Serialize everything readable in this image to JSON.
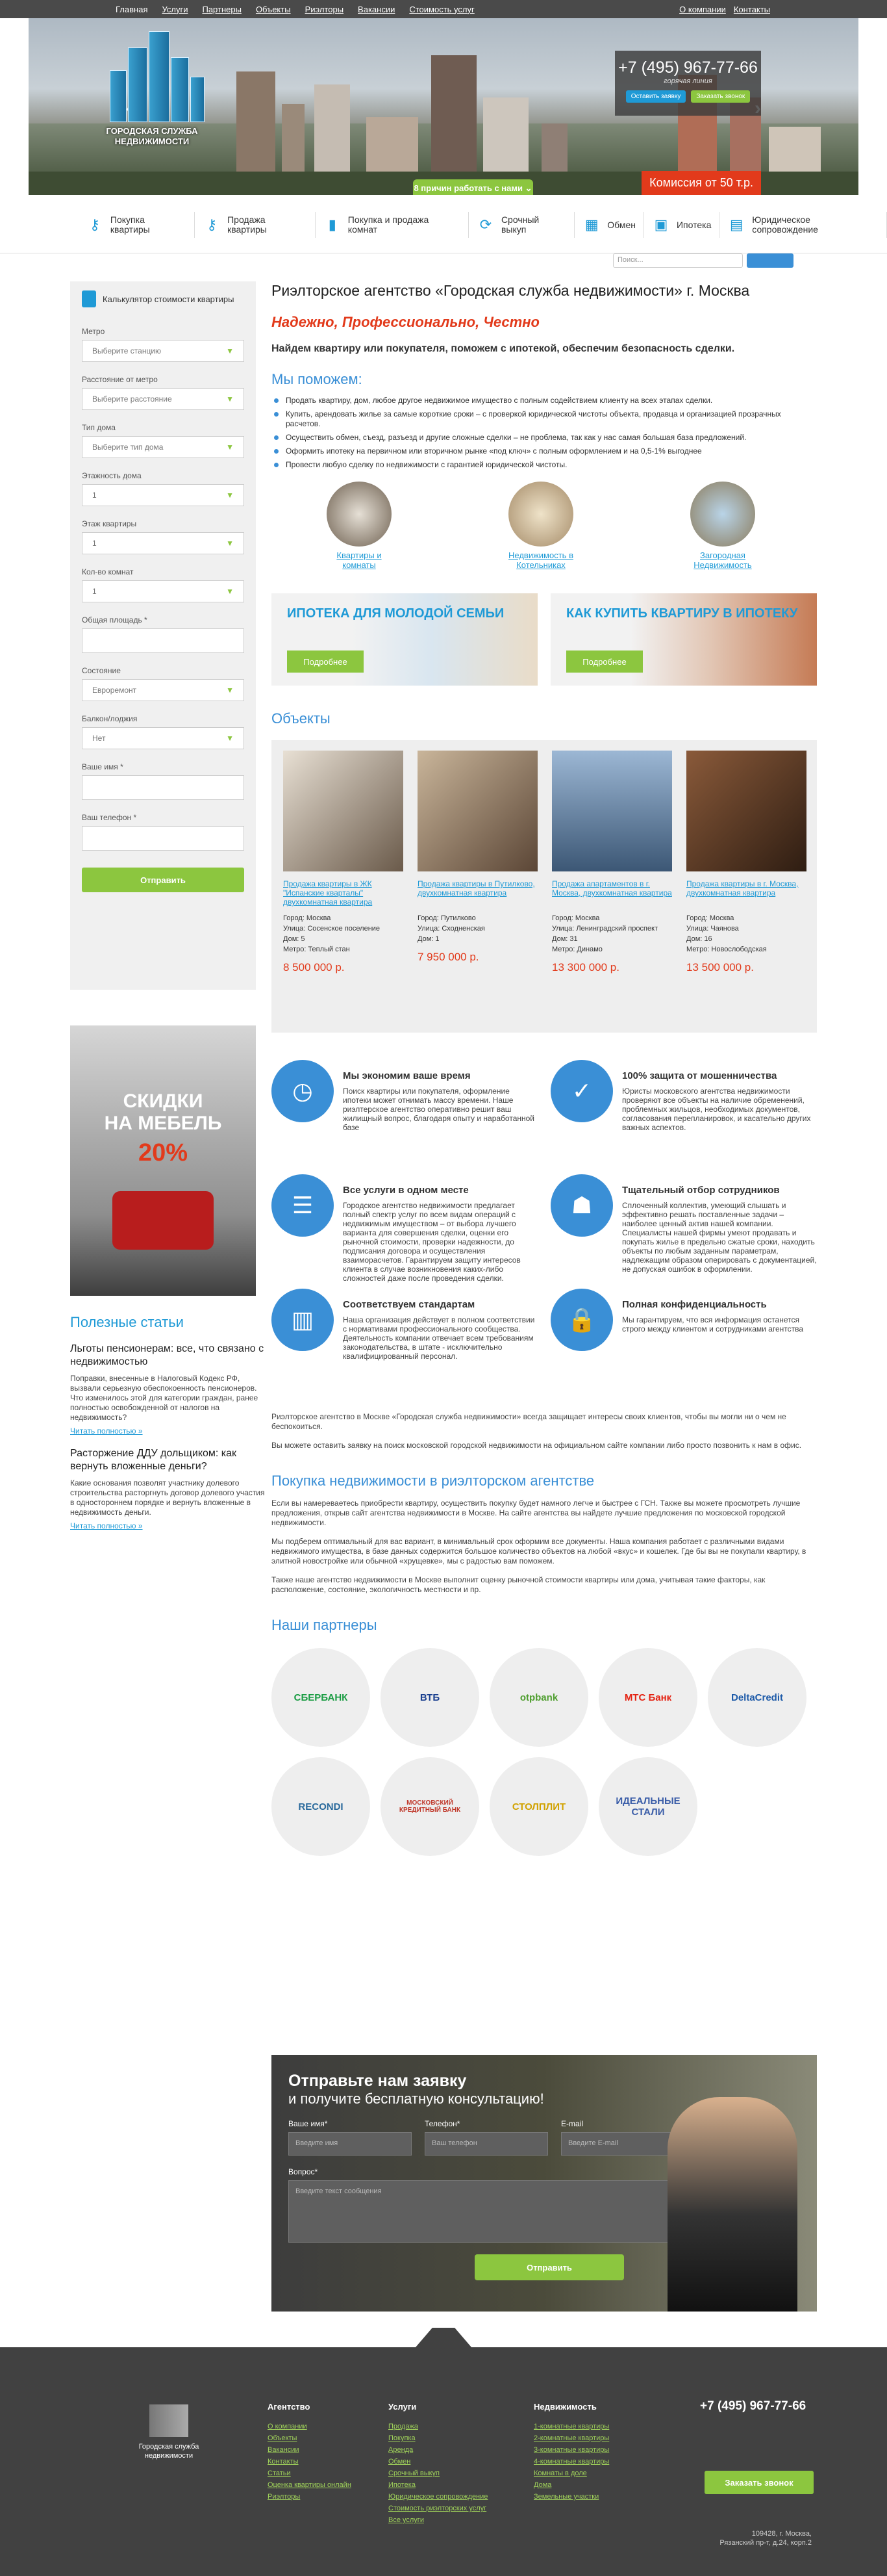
{
  "topnav": [
    "Главная",
    "Услуги",
    "Партнеры",
    "Объекты",
    "Риэлторы",
    "Вакансии",
    "Стоимость услуг"
  ],
  "topright": {
    "about": "О компании",
    "contacts": "Контакты"
  },
  "logo": "Городская служба недвижимости",
  "banner": {
    "phone": "+7 (495) 967-77-66",
    "phone_sub": "горячая линия",
    "btn1": "Оставить заявку",
    "btn2": "Заказать звонок",
    "commission": "Комиссия от 50 т.р.",
    "reasons": "8 причин работать с нами"
  },
  "nav": [
    {
      "label": "Покупка квартиры",
      "icon": "key-icon"
    },
    {
      "label": "Продажа квартиры",
      "icon": "key-icon"
    },
    {
      "label": "Покупка и продажа комнат",
      "icon": "bookmark-icon"
    },
    {
      "label": "Срочный выкуп",
      "icon": "refresh-icon"
    },
    {
      "label": "Обмен",
      "icon": "building-icon"
    },
    {
      "label": "Ипотека",
      "icon": "briefcase-icon"
    },
    {
      "label": "Юридическое сопровождение",
      "icon": "document-icon"
    }
  ],
  "search_placeholder": "Поиск...",
  "calc": {
    "title": "Калькулятор стоимости квартиры",
    "fields": [
      {
        "label": "Метро",
        "value": "Выберите станцию"
      },
      {
        "label": "Расстояние от метро",
        "value": "Выберите расстояние"
      },
      {
        "label": "Тип дома",
        "value": "Выберите тип дома"
      },
      {
        "label": "Этажность дома",
        "value": "1"
      },
      {
        "label": "Этаж квартиры",
        "value": "1"
      },
      {
        "label": "Кол-во комнат",
        "value": "1"
      }
    ],
    "area": "Общая площадь *",
    "fields2": [
      {
        "label": "Состояние",
        "value": "Евроремонт"
      },
      {
        "label": "Балкон/лоджия",
        "value": "Нет"
      }
    ],
    "name": "Ваше имя *",
    "phone": "Ваш телефон *",
    "submit": "Отправить"
  },
  "ad": {
    "line1": "СКИДКИ",
    "line2": "НА МЕБЕЛЬ",
    "percent": "20%"
  },
  "articles": {
    "title": "Полезные статьи",
    "items": [
      {
        "title": "Льготы пенсионерам: все, что связано с недвижимостью",
        "text": "Поправки, внесенные в Налоговый Кодекс РФ, вызвали серьезную обеспокоенность пенсионеров. Что изменилось этой для категории граждан, ранее полностью освобожденной от налогов на недвижимость?",
        "more": "Читать полностью »"
      },
      {
        "title": "Расторжение ДДУ дольщиком: как вернуть вложенные деньги?",
        "text": "Какие основания позволят участнику долевого строительства расторгнуть договор долевого участия в одностороннем порядке и вернуть вложенные в недвижимость деньги.",
        "more": "Читать полностью »"
      }
    ]
  },
  "main": {
    "title": "Риэлторское агентство «Городская служба недвижимости» г. Москва",
    "slogan": "Надежно, Профессионально, Честно",
    "lead": "Найдем квартиру или покупателя, поможем с ипотекой, обеспечим безопасность сделки.",
    "help_title": "Мы поможем:",
    "help": [
      "Продать квартиру, дом, любое другое недвижимое имущество с полным содействием клиенту на всех этапах сделки.",
      "Купить, арендовать жилье за самые короткие сроки – с проверкой юридической чистоты объекта, продавца и организацией прозрачных расчетов.",
      "Осуществить обмен, съезд, разъезд и другие сложные сделки – не проблема, так как у нас самая большая база предложений.",
      "Оформить ипотеку на первичном или вторичном рынке «под ключ» с полным оформлением и на 0,5-1% выгоднее",
      "Провести любую сделку по недвижимости с гарантией юридической чистоты."
    ],
    "tiles": [
      "Квартиры и комнаты",
      "Недвижимость в Котельниках",
      "Загородная Недвижимость"
    ],
    "promos": [
      {
        "title": "ИПОТЕКА ДЛЯ МОЛОДОЙ СЕМЬИ",
        "btn": "Подробнее"
      },
      {
        "title": "КАК КУПИТЬ КВАРТИРУ В ИПОТЕКУ",
        "btn": "Подробнее"
      }
    ],
    "objects_title": "Объекты",
    "objects": [
      {
        "link": "Продажа квартиры в ЖК \"Испанские кварталы\" двухкомнатная квартира",
        "city": "Город: Москва",
        "street": "Улица: Сосенское поселение",
        "house": "Дом: 5",
        "metro": "Метро: Теплый стан",
        "price": "8 500 000 р."
      },
      {
        "link": "Продажа квартиры в Путилково, двухкомнатная квартира",
        "city": "Город: Путилково",
        "street": "Улица: Сходненская",
        "house": "Дом: 1",
        "metro": "",
        "price": "7 950 000 р."
      },
      {
        "link": "Продажа апартаментов в г. Москва, двухкомнатная квартира",
        "city": "Город: Москва",
        "street": "Улица: Ленинградский проспект",
        "house": "Дом: 31",
        "metro": "Метро: Динамо",
        "price": "13 300 000 р."
      },
      {
        "link": "Продажа квартиры в г. Москва, двухкомнатная квартира",
        "city": "Город: Москва",
        "street": "Улица: Чаянова",
        "house": "Дом: 16",
        "metro": "Метро: Новослободская",
        "price": "13 500 000 р."
      }
    ],
    "features": [
      {
        "title": "Мы экономим ваше время",
        "text": "Поиск квартиры или покупателя, оформление ипотеки может отнимать массу времени. Наше риэлтерское агентство оперативно решит ваш жилищный вопрос, благодаря опыту и наработанной базе",
        "icon": "clock-icon"
      },
      {
        "title": "100% защита от мошенничества",
        "text": "Юристы московского агентства недвижимости проверяют все объекты на наличие обременений, проблемных жильцов, необходимых документов, согласования перепланировок, и касательно других важных аспектов.",
        "icon": "shield-icon"
      },
      {
        "title": "Все услуги в одном месте",
        "text": "Городское агентство недвижимости предлагает полный спектр услуг по всем видам операций с недвижимым имуществом – от выбора лучшего варианта для совершения сделки, оценки его рыночной стоимости, проверки надежности, до подписания договора и осуществления взаиморасчетов. Гарантируем защиту интересов клиента в случае возникновения каких-либо сложностей даже после проведения сделки.",
        "icon": "checklist-icon"
      },
      {
        "title": "Тщательный отбор сотрудников",
        "text": "Сплоченный коллектив, умеющий слышать и эффективно решать поставленные задачи – наиболее ценный актив нашей компании. Специалисты нашей фирмы умеют продавать и покупать жилье в предельно сжатые сроки, находить объекты по любым заданным параметрам, надлежащим образом оперировать с документацией, не допуская ошибок в оформлении.",
        "icon": "team-icon"
      },
      {
        "title": "Соответствуем стандартам",
        "text": "Наша организация действует в полном соответствии с нормативами профессионального сообщества. Деятельность компании отвечает всем требованиям законодательства, в штате - исключительно квалифицированный персонал.",
        "icon": "chart-icon"
      },
      {
        "title": "Полная конфиденциальность",
        "text": "Мы гарантируем, что вся информация останется строго между клиентом и сотрудниками агентства",
        "icon": "lock-icon"
      }
    ],
    "txt1": "Риэлторское агентство в Москве «Городская служба недвижимости» всегда защищает интересы своих клиентов, чтобы вы могли ни о чем не беспокоиться.",
    "txt2": "Вы можете оставить заявку на поиск московской городской недвижимости на официальном сайте компании либо просто позвонить к нам в офис.",
    "buy_title": "Покупка недвижимости в риэлторском агентстве",
    "buy": [
      "Если вы намереваетесь приобрести квартиру, осуществить покупку будет намного легче и быстрее с ГСН. Также вы можете просмотреть лучшие предложения, открыв сайт агентства недвижимости в Москве. На сайте агентства вы найдете лучшие предложения по московской городской недвижимости.",
      "Мы подберем оптимальный для вас вариант, в минимальный срок оформим все документы. Наша компания работает с различными видами недвижимого имущества, в базе данных содержится большое количество объектов на любой «вкус» и кошелек. Где бы вы не покупали квартиру, в элитной новостройке или обычной «хрущевке», мы с радостью вам поможем.",
      "Также наше агентство недвижимости в Москве выполнит оценку рыночной стоимости квартиры или дома, учитывая такие факторы, как расположение, состояние, экологичность местности и пр."
    ],
    "partners_title": "Наши партнеры",
    "partners": [
      "СБЕРБАНК",
      "ВТБ",
      "otpbank",
      "МТС Банк",
      "DeltaCredit",
      "RECONDI",
      "МОСКОВСКИЙ КРЕДИТНЫЙ БАНК",
      "СТОЛПЛИТ",
      "ИДЕАЛЬНЫЕ СТАЛИ"
    ]
  },
  "callform": {
    "title1": "Отправьте нам заявку",
    "title2": "и получите бесплатную консультацию!",
    "name_l": "Ваше имя*",
    "name_p": "Введите имя",
    "phone_l": "Телефон*",
    "phone_p": "Ваш телефон",
    "email_l": "E-mail",
    "email_p": "Введите E-mail",
    "q_l": "Вопрос*",
    "q_p": "Введите текст сообщения",
    "submit": "Отправить"
  },
  "footer": {
    "logo": "Городская служба недвижимости",
    "col1": {
      "title": "Агентство",
      "items": [
        "О компании",
        "Объекты",
        "Вакансии",
        "Контакты",
        "Статьи",
        "Оценка квартиры онлайн",
        "Риэлторы"
      ]
    },
    "col2": {
      "title": "Услуги",
      "items": [
        "Продажа",
        "Покупка",
        "Аренда",
        "Обмен",
        "Срочный выкуп",
        "Ипотека",
        "Юридическое сопровождение",
        "Стоимость риэлторских услуг",
        "Все услуги"
      ]
    },
    "col3": {
      "title": "Недвижимость",
      "items": [
        "1-комнатные квартиры",
        "2-комнатные квартиры",
        "3-комнатные квартиры",
        "4-комнатные квартиры",
        "Комнаты в доле",
        "Дома",
        "Земельные участки"
      ]
    },
    "phone": "+7 (495) 967-77-66",
    "btn": "Заказать звонок",
    "addr1": "109428, г. Москва,",
    "addr2": "Рязанский пр-т, д.24, корп.2"
  }
}
